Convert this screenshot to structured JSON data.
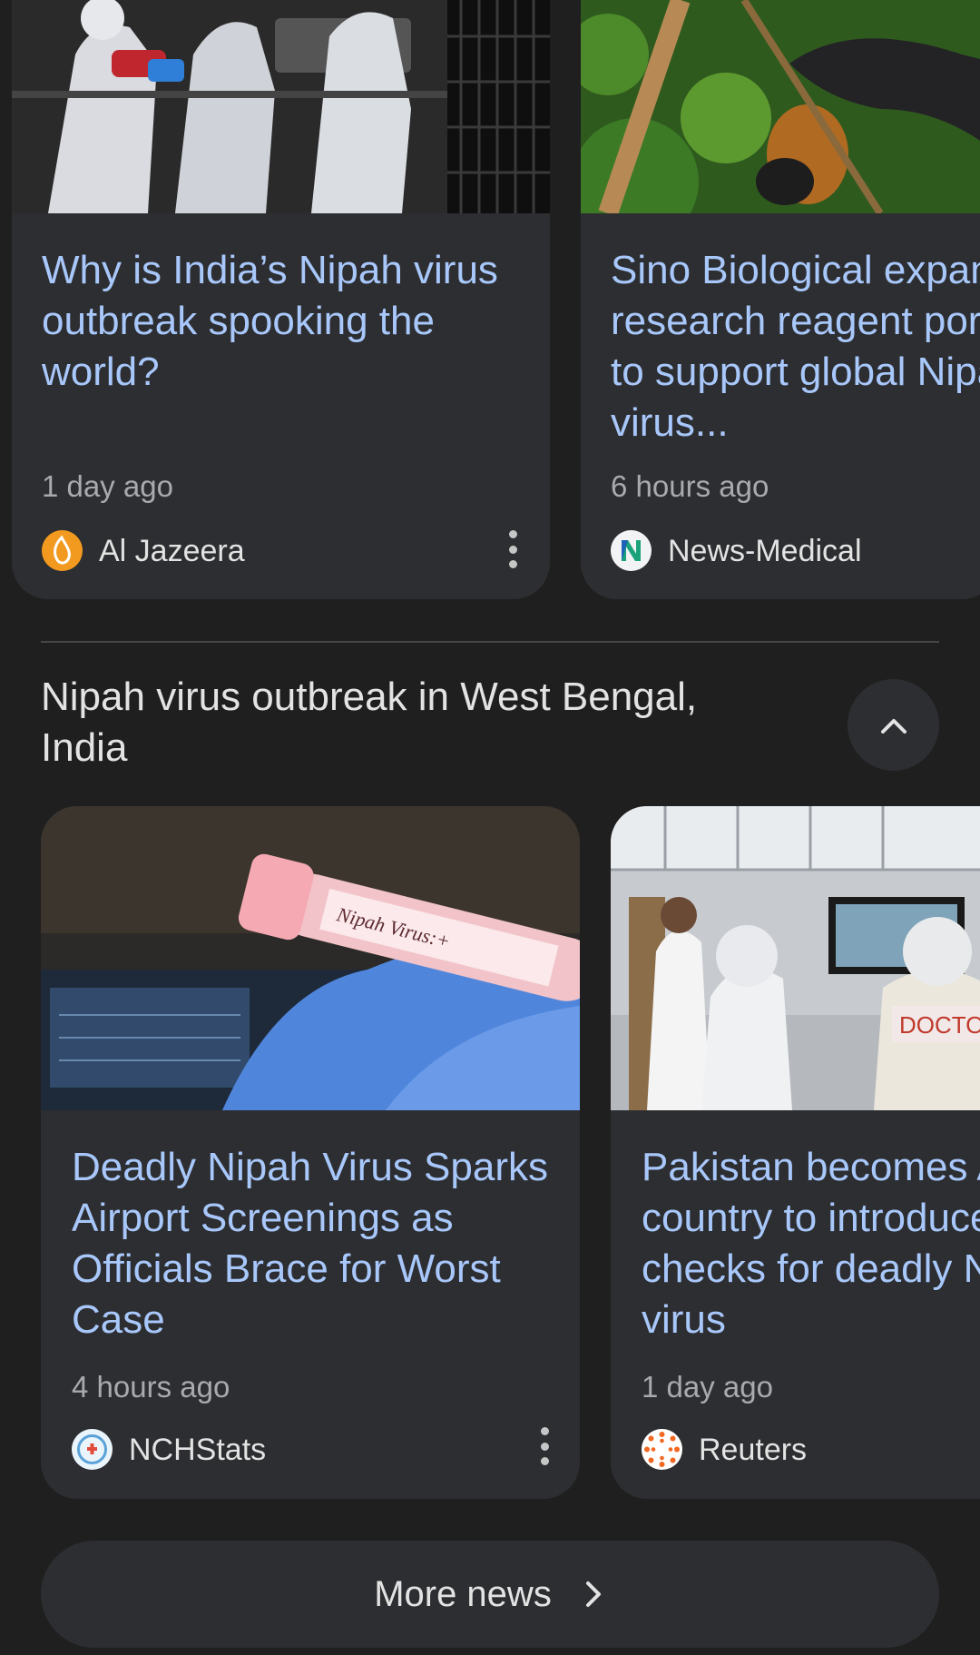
{
  "top_cards": [
    {
      "title": "Why is India’s Nipah virus outbreak spooking the world?",
      "time": "1 day ago",
      "source": "Al Jazeera",
      "source_logo": "al-jazeera-logo",
      "image": "health-workers-in-protective-suits-photo"
    },
    {
      "title": "Sino Biological expands research reagent portfolio to support global Nipah virus...",
      "time": "6 hours ago",
      "source": "News-Medical",
      "source_logo": "news-medical-logo",
      "image": "fruit-bat-photo"
    }
  ],
  "section": {
    "title": "Nipah virus outbreak in West Bengal, India",
    "collapse_icon": "chevron-up-icon"
  },
  "section_cards": [
    {
      "title": "Deadly Nipah Virus Sparks Airport Screenings as Officials Brace for Worst Case",
      "time": "4 hours ago",
      "source": "NCHStats",
      "source_logo": "nchstats-logo",
      "image": "nipah-virus-test-tube-photo",
      "image_text": "Nipah Virus:+"
    },
    {
      "title": "Pakistan becomes Asian country to introduce checks for deadly Nipah virus",
      "time": "1 day ago",
      "source": "Reuters",
      "source_logo": "reuters-logo",
      "image": "airport-screening-photo",
      "image_text": "DOCTO"
    }
  ],
  "more_news": {
    "label": "More news",
    "icon": "chevron-right-icon"
  },
  "colors": {
    "background": "#1f1f1f",
    "card": "#2d2e31",
    "link": "#a8c7fa",
    "secondary_text": "#a9aaad",
    "primary_text": "#e3e3e3"
  }
}
